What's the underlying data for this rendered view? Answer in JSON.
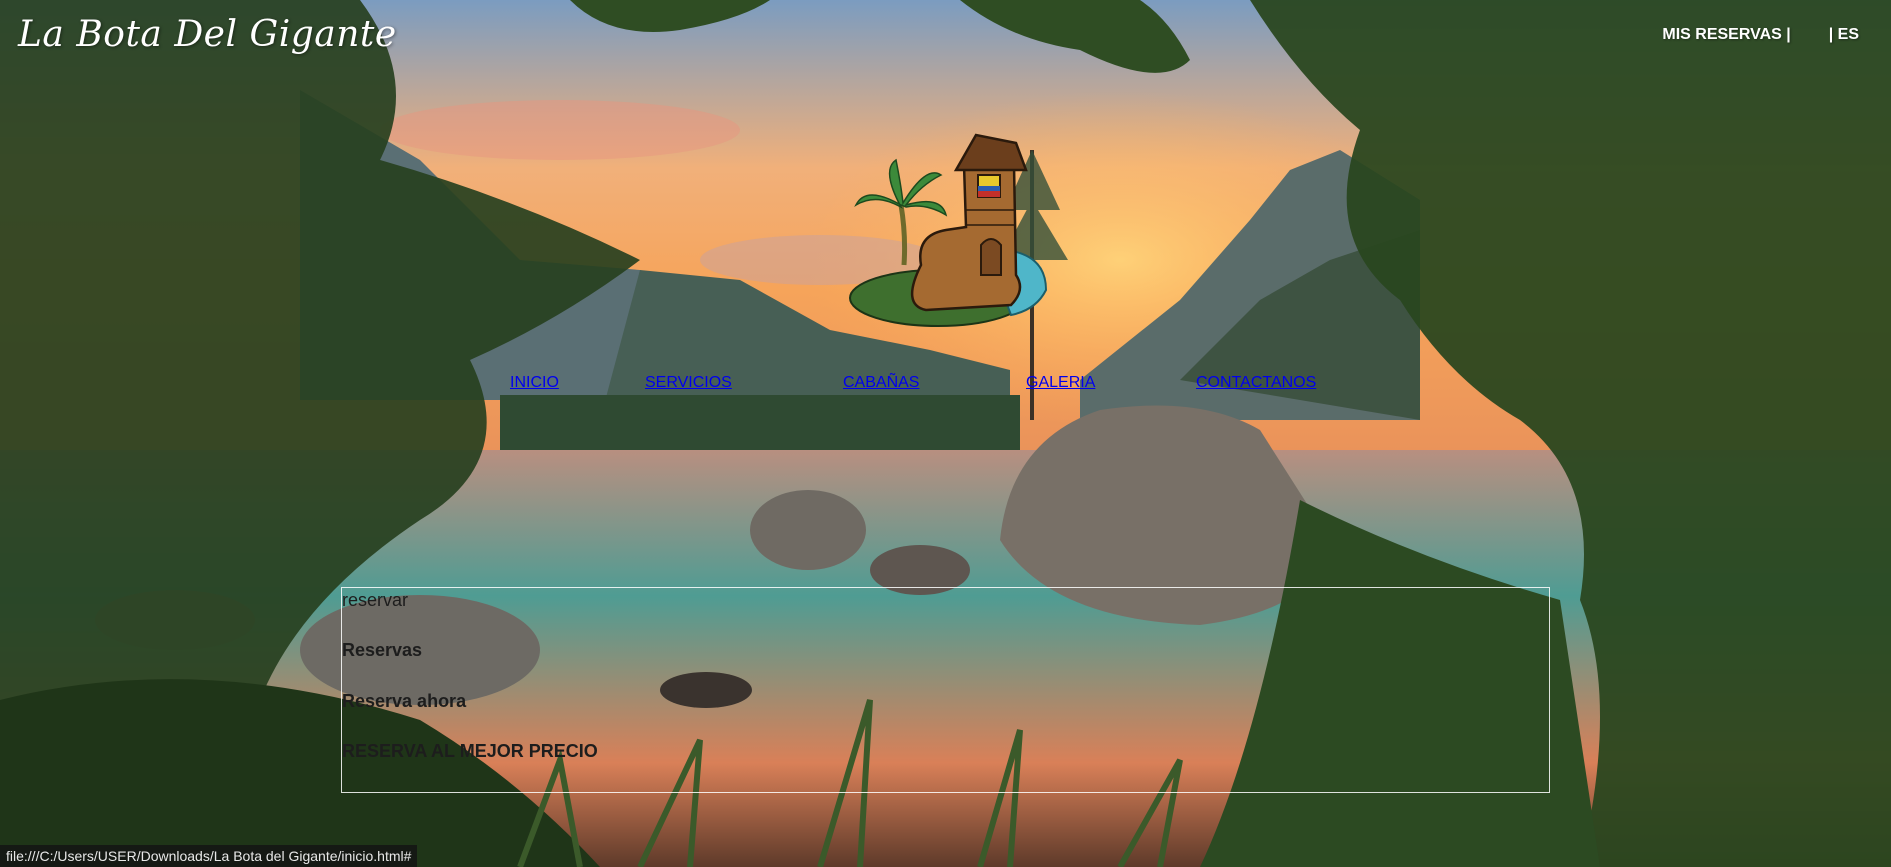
{
  "header": {
    "brand": "La Bota Del Gigante",
    "links": {
      "reservations": "MIS RESERVAS |",
      "language": "| ES"
    }
  },
  "nav": {
    "items": [
      "INICIO",
      "SERVICIOS",
      "CABAÑAS",
      "GALERIA",
      "CONTACTANOS"
    ]
  },
  "booking": {
    "placeholder": "reservar",
    "title": "Reservas",
    "cta": "Reserva ahora",
    "promo": "RESERVA AL MEJOR PRECIO"
  },
  "status_bar": {
    "url": "file:///C:/Users/USER/Downloads/La Bota del Gigante/inicio.html#"
  },
  "colors": {
    "sky_top": "#6b8fb0",
    "sunset": "#f3a85f",
    "mountain": "#3f5646",
    "lake": "#5a9a8c",
    "foliage": "#24401f"
  },
  "icons": {
    "logo": "boot-house-logo"
  }
}
